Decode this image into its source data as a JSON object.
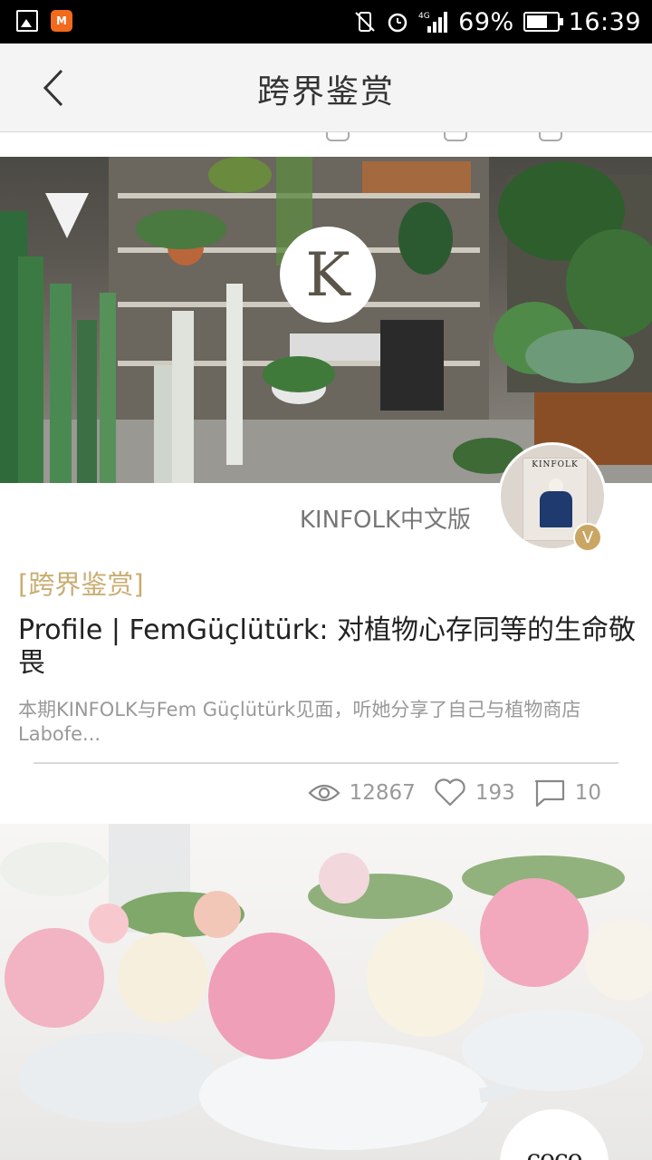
{
  "status_bar": {
    "battery": "69%",
    "time": "16:39",
    "network": "4G"
  },
  "nav": {
    "title": "跨界鉴赏"
  },
  "article1": {
    "logo_letter": "K",
    "source": "KINFOLK中文版",
    "avatar_book_title": "KINFOLK",
    "verified_badge": "V",
    "category": "[跨界鉴赏]",
    "title": "Profile | FemGüçlütürk: 对植物心存同等的生命敬畏",
    "summary": "本期KINFOLK与Fem Güçlütürk见面，听她分享了自己与植物商店Labofe...",
    "views": "12867",
    "likes": "193",
    "comments": "10"
  },
  "article2": {
    "logo_text": "coco"
  },
  "colors": {
    "accent_gold": "#c9ad72",
    "badge_gold": "#c9a663",
    "nav_bg": "#f4f4f4"
  }
}
